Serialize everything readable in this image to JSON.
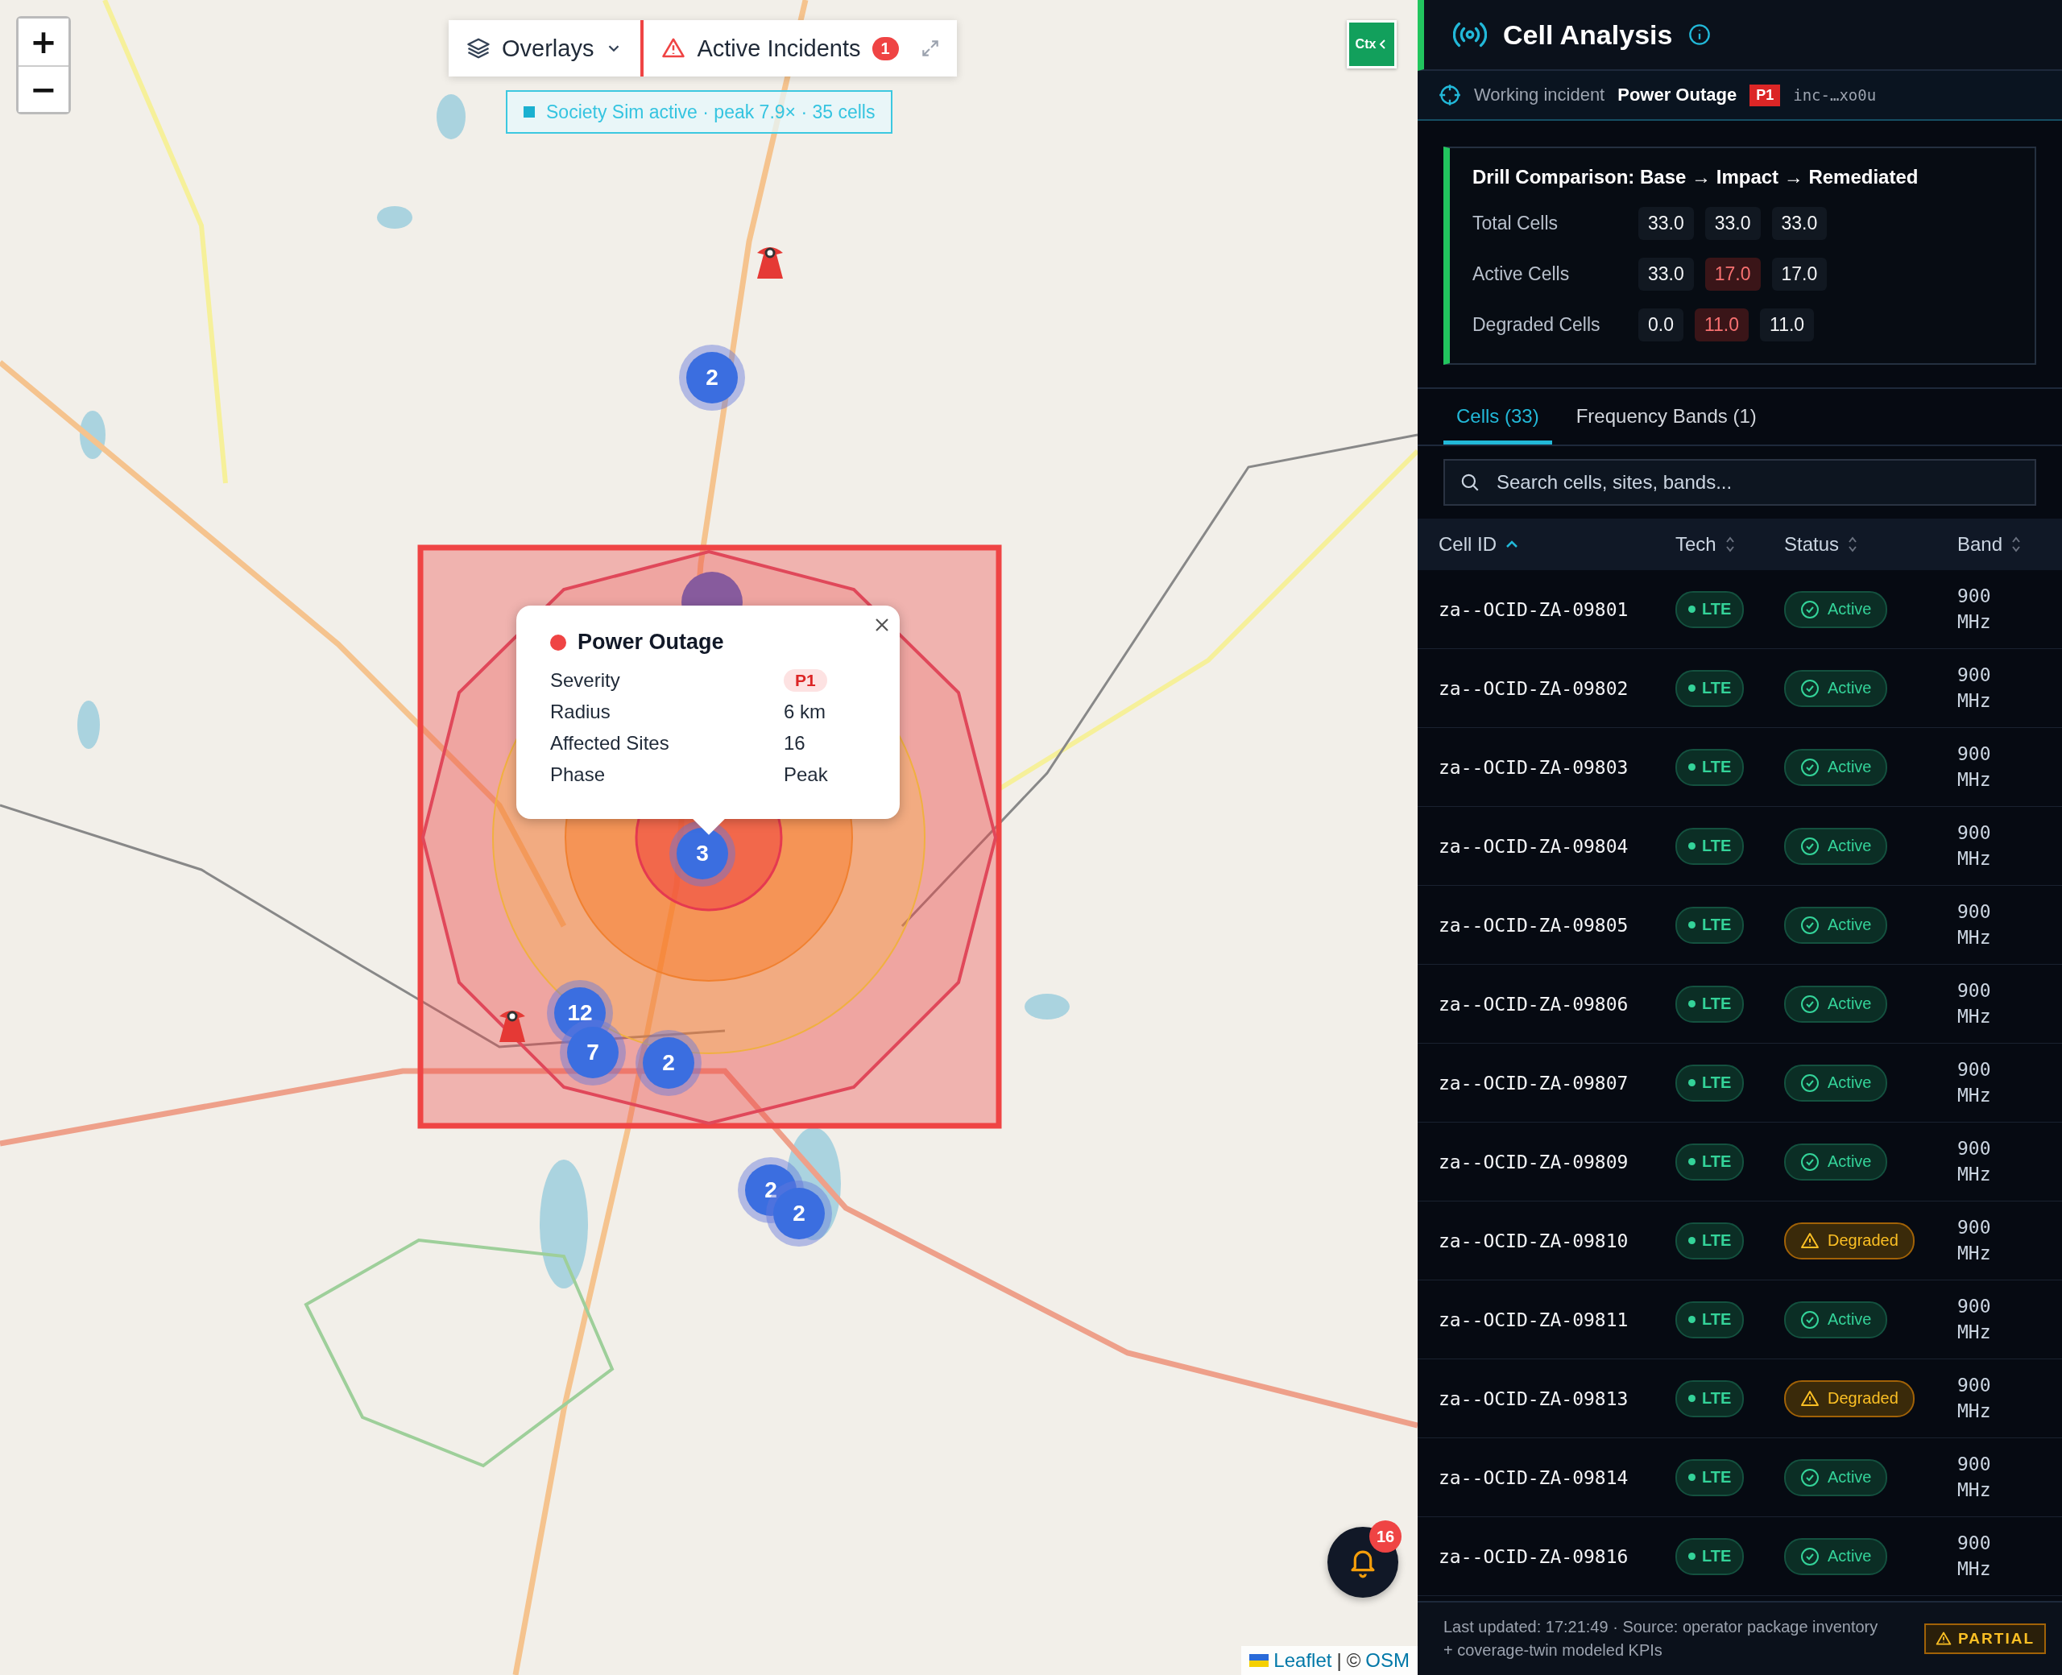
{
  "map": {
    "zoom_controls": [
      "+",
      "−"
    ],
    "toolbar": {
      "overlays": "Overlays",
      "incidents": {
        "label": "Active Incidents",
        "count": "1"
      }
    },
    "sim_banner": "Society Sim active · peak 7.9× · 35 cells",
    "ctx_button": "Ctx",
    "clusters": [
      {
        "count": "2"
      },
      {
        "count": "3"
      },
      {
        "count": "12"
      },
      {
        "count": "7"
      },
      {
        "count": "2"
      },
      {
        "count": "2"
      },
      {
        "count": "2"
      }
    ],
    "popup": {
      "title": "Power Outage",
      "rows": [
        {
          "label": "Severity",
          "value": "P1",
          "kind": "badge"
        },
        {
          "label": "Radius",
          "value": "6 km",
          "kind": "text"
        },
        {
          "label": "Affected Sites",
          "value": "16",
          "kind": "text"
        },
        {
          "label": "Phase",
          "value": "Peak",
          "kind": "text"
        }
      ]
    },
    "notifications": {
      "count": "16"
    },
    "attribution": {
      "link": "Leaflet",
      "separator": "|",
      "copyright": "©",
      "source": "OSM"
    }
  },
  "panel": {
    "title": "Cell Analysis",
    "incident": {
      "prefix": "Working incident",
      "name": "Power Outage",
      "severity": "P1",
      "id": "inc-…xo0u"
    },
    "drill": {
      "title": "Drill Comparison: Base → Impact → Remediated",
      "rows": [
        {
          "label": "Total Cells",
          "values": [
            {
              "text": "33.0",
              "changed": false
            },
            {
              "text": "33.0",
              "changed": false
            },
            {
              "text": "33.0",
              "changed": false
            }
          ]
        },
        {
          "label": "Active Cells",
          "values": [
            {
              "text": "33.0",
              "changed": false
            },
            {
              "text": "17.0",
              "changed": true
            },
            {
              "text": "17.0",
              "changed": false
            }
          ]
        },
        {
          "label": "Degraded Cells",
          "values": [
            {
              "text": "0.0",
              "changed": false
            },
            {
              "text": "11.0",
              "changed": true
            },
            {
              "text": "11.0",
              "changed": false
            }
          ]
        }
      ]
    },
    "tabs": [
      {
        "label": "Cells (33)",
        "selected": true
      },
      {
        "label": "Frequency Bands (1)",
        "selected": false
      }
    ],
    "search": {
      "placeholder": "Search cells, sites, bands..."
    },
    "table": {
      "columns": [
        {
          "label": "Cell ID",
          "sorted": true
        },
        {
          "label": "Tech",
          "sorted": false
        },
        {
          "label": "Status",
          "sorted": false
        },
        {
          "label": "Band",
          "sorted": false
        }
      ],
      "rows": [
        {
          "cell_id": "za--OCID-ZA-09801",
          "tech": "LTE",
          "status": "Active",
          "kind": "active",
          "band": "900 MHz"
        },
        {
          "cell_id": "za--OCID-ZA-09802",
          "tech": "LTE",
          "status": "Active",
          "kind": "active",
          "band": "900 MHz"
        },
        {
          "cell_id": "za--OCID-ZA-09803",
          "tech": "LTE",
          "status": "Active",
          "kind": "active",
          "band": "900 MHz"
        },
        {
          "cell_id": "za--OCID-ZA-09804",
          "tech": "LTE",
          "status": "Active",
          "kind": "active",
          "band": "900 MHz"
        },
        {
          "cell_id": "za--OCID-ZA-09805",
          "tech": "LTE",
          "status": "Active",
          "kind": "active",
          "band": "900 MHz"
        },
        {
          "cell_id": "za--OCID-ZA-09806",
          "tech": "LTE",
          "status": "Active",
          "kind": "active",
          "band": "900 MHz"
        },
        {
          "cell_id": "za--OCID-ZA-09807",
          "tech": "LTE",
          "status": "Active",
          "kind": "active",
          "band": "900 MHz"
        },
        {
          "cell_id": "za--OCID-ZA-09809",
          "tech": "LTE",
          "status": "Active",
          "kind": "active",
          "band": "900 MHz"
        },
        {
          "cell_id": "za--OCID-ZA-09810",
          "tech": "LTE",
          "status": "Degraded",
          "kind": "degraded",
          "band": "900 MHz"
        },
        {
          "cell_id": "za--OCID-ZA-09811",
          "tech": "LTE",
          "status": "Active",
          "kind": "active",
          "band": "900 MHz"
        },
        {
          "cell_id": "za--OCID-ZA-09813",
          "tech": "LTE",
          "status": "Degraded",
          "kind": "degraded",
          "band": "900 MHz"
        },
        {
          "cell_id": "za--OCID-ZA-09814",
          "tech": "LTE",
          "status": "Active",
          "kind": "active",
          "band": "900 MHz"
        },
        {
          "cell_id": "za--OCID-ZA-09816",
          "tech": "LTE",
          "status": "Active",
          "kind": "active",
          "band": "900 MHz"
        }
      ]
    },
    "footer": {
      "text": "Last updated: 17:21:49 · Source: operator package inventory + coverage-twin modeled KPIs",
      "badge": "PARTIAL"
    }
  }
}
